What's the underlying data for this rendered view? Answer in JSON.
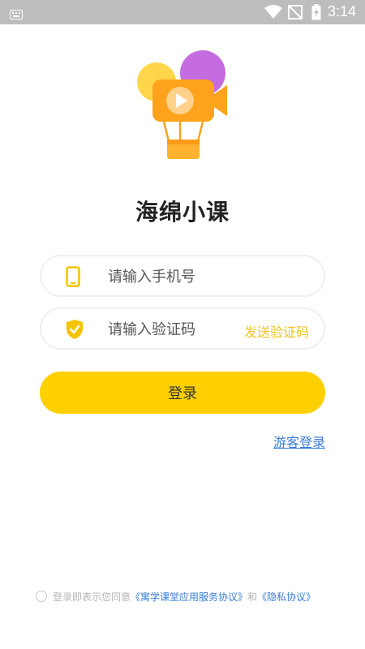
{
  "status_bar": {
    "time": "3:14",
    "icons": [
      "keyboard-icon",
      "wifi-icon",
      "no-signal-icon",
      "battery-charging-icon"
    ]
  },
  "app": {
    "title": "海绵小课",
    "logo": "hot-air-balloon-video-camera-logo"
  },
  "form": {
    "phone_placeholder": "请输入手机号",
    "phone_icon": "mobile-phone-icon",
    "code_placeholder": "请输入验证码",
    "code_icon": "shield-check-icon",
    "send_code_label": "发送验证码",
    "login_label": "登录",
    "guest_login_label": "游客登录"
  },
  "agreement": {
    "prefix": "登录即表示您同意",
    "service_link": "《寓学课堂应用服务协议》",
    "conjunction": "和",
    "privacy_link": "《隐私协议》",
    "checked": false
  },
  "colors": {
    "accent": "#ffd000",
    "link": "#3a7dd8",
    "send_code": "#f2c328",
    "status_bar": "#bdbdbd"
  }
}
